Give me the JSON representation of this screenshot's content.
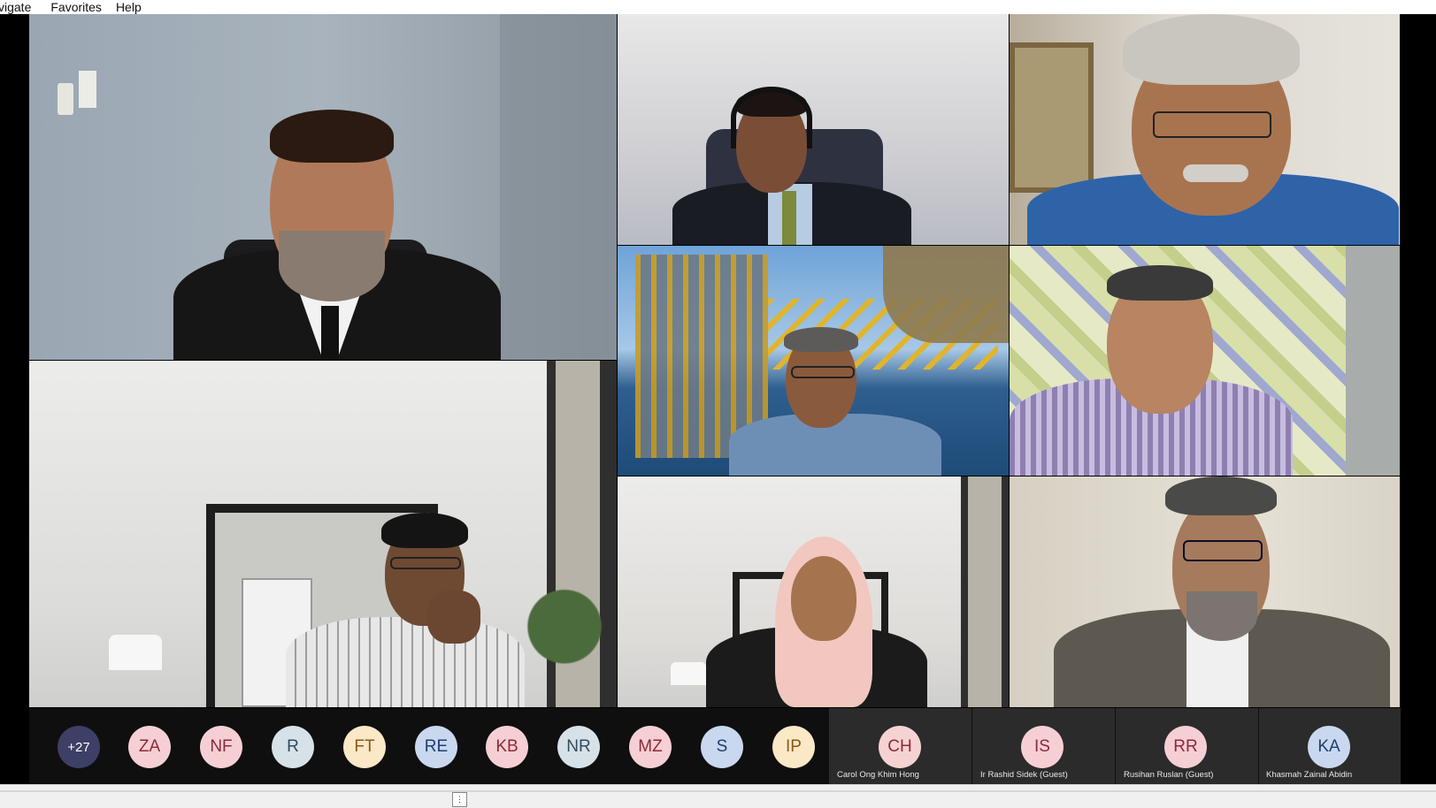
{
  "menu": {
    "items": [
      "vigate",
      "Favorites",
      "Help"
    ]
  },
  "overflow_count": "+27",
  "avatars": [
    {
      "initials": "+27",
      "bg": "#3d3f66",
      "fg": "#ffffff"
    },
    {
      "initials": "ZA",
      "bg": "#f6cfd5",
      "fg": "#8c2a3a"
    },
    {
      "initials": "NF",
      "bg": "#f6cfd5",
      "fg": "#8c2a3a"
    },
    {
      "initials": "R",
      "bg": "#d7e1e8",
      "fg": "#2f4b5f"
    },
    {
      "initials": "FT",
      "bg": "#fbe8c6",
      "fg": "#8a5a17"
    },
    {
      "initials": "RE",
      "bg": "#c9d8ef",
      "fg": "#1f3e70"
    },
    {
      "initials": "KB",
      "bg": "#f6cfd5",
      "fg": "#8c2a3a"
    },
    {
      "initials": "NR",
      "bg": "#d7e1e8",
      "fg": "#2f4b5f"
    },
    {
      "initials": "MZ",
      "bg": "#f6cfd5",
      "fg": "#8c2a3a"
    },
    {
      "initials": "S",
      "bg": "#c9d8ef",
      "fg": "#1f3e70"
    },
    {
      "initials": "IP",
      "bg": "#fbe8c6",
      "fg": "#8a5a17"
    }
  ],
  "named_participants": [
    {
      "initials": "CH",
      "name": "Carol Ong Khim Hong",
      "bg": "#f6d3d3",
      "fg": "#8c2a3a"
    },
    {
      "initials": "IS",
      "name": "Ir Rashid  Sidek (Guest)",
      "bg": "#f6cfd5",
      "fg": "#8c2a3a"
    },
    {
      "initials": "RR",
      "name": "Rusihan Ruslan (Guest)",
      "bg": "#f6cfd5",
      "fg": "#8c2a3a"
    },
    {
      "initials": "KA",
      "name": "Khasmah Zainal Abidin",
      "bg": "#c9d8ef",
      "fg": "#1f3e70"
    }
  ]
}
